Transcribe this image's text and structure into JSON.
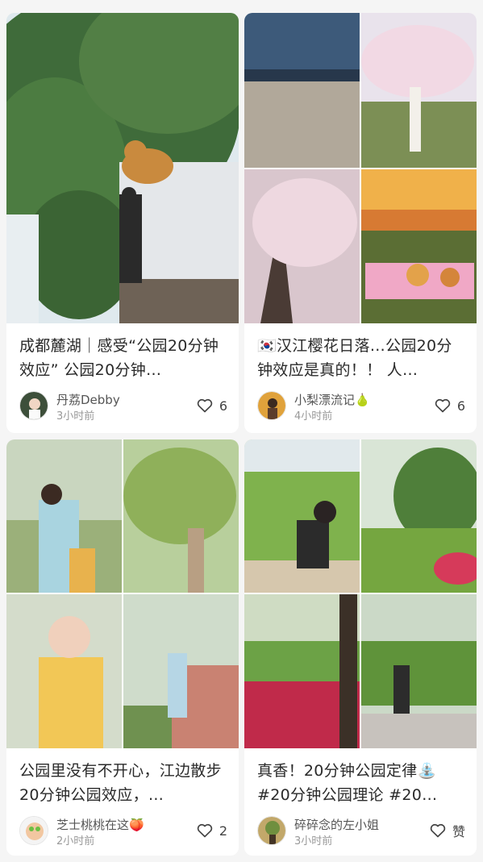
{
  "feed": {
    "cards": [
      {
        "title": "成都麓湖｜感受“公园20分钟效应” 公园20分钟…",
        "author": "丹荔Debby",
        "time": "3小时前",
        "likes": "6",
        "avatar": "avatar-girl-icon"
      },
      {
        "title": "🇰🇷汉江樱花日落…公园20分钟效应是真的！！ 人…",
        "author": "小梨漂流记🍐",
        "time": "4小时前",
        "likes": "6",
        "avatar": "avatar-person-icon"
      },
      {
        "title": "公园里没有不开心，江边散步 20分钟公园效应，…",
        "author": "芝士桃桃在这🍑",
        "time": "2小时前",
        "likes": "2",
        "avatar": "avatar-cartoon-icon"
      },
      {
        "title": "真香！20分钟公园定律⛲ #20分钟公园理论 #20…",
        "author": "碎碎念的左小姐",
        "time": "3小时前",
        "likes": "赞",
        "avatar": "avatar-outdoor-icon"
      }
    ]
  },
  "colors": {
    "page_background": "#f5f5f5",
    "card_background": "#ffffff",
    "text_primary": "#2a2a2a",
    "text_secondary": "#999999"
  }
}
